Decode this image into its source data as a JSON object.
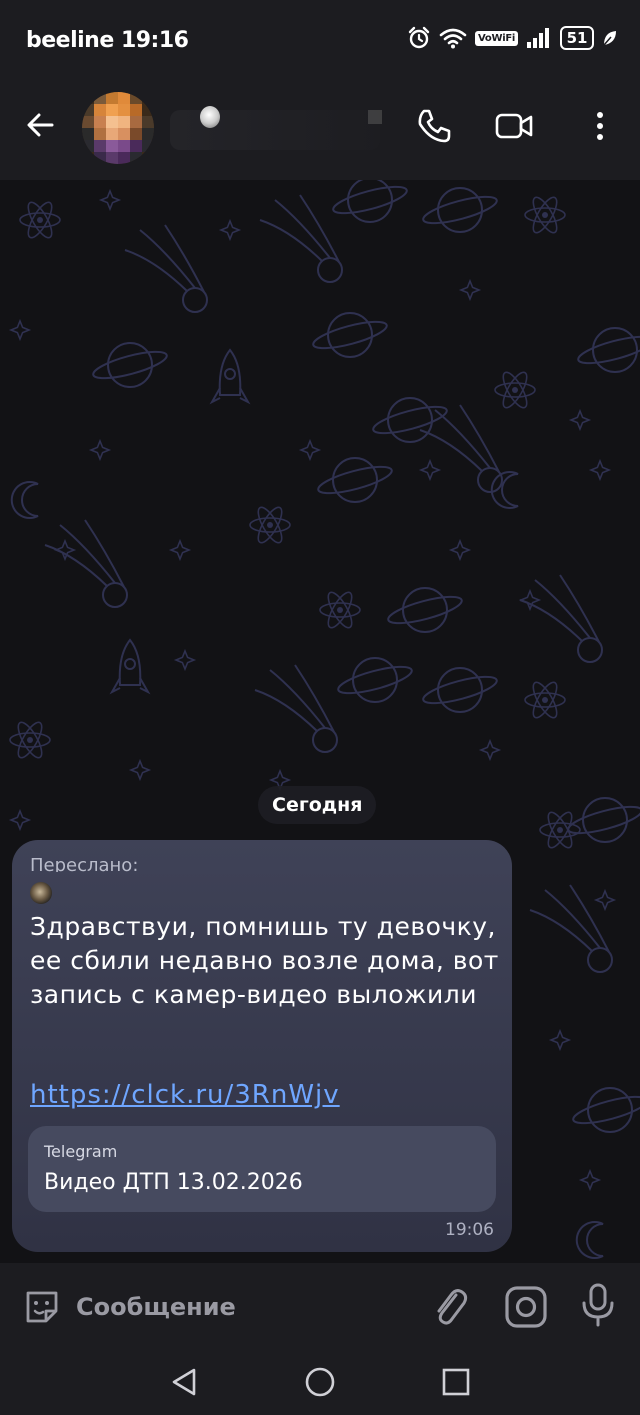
{
  "status_bar": {
    "carrier": "beeline",
    "time": "19:16",
    "vowifi": "VoWiFi",
    "battery": "51"
  },
  "header": {
    "back_icon": "arrow-left-icon",
    "call_icon": "phone-icon",
    "video_icon": "video-camera-icon",
    "menu_icon": "more-vertical-icon"
  },
  "chat": {
    "date_separator": "Сегодня",
    "message": {
      "forwarded_label": "Переслано:",
      "text": "Здравствуи, помнишь ту девочку, ее сбили недавно возле дома, вот запись с камер-видео выложили",
      "link": "https://clck.ru/3RnWjv",
      "preview": {
        "site": "Telegram",
        "title": "Видео ДТП 13.02.2026"
      },
      "time": "19:06"
    }
  },
  "composer": {
    "placeholder": "Сообщение",
    "sticker_icon": "sticker-icon",
    "attach_icon": "paperclip-icon",
    "camera_icon": "camera-icon",
    "mic_icon": "microphone-icon"
  },
  "colors": {
    "bar_background": "#1c1c20",
    "chat_background": "#121215",
    "bubble": "#3a3d50",
    "link": "#6fa6ff"
  }
}
